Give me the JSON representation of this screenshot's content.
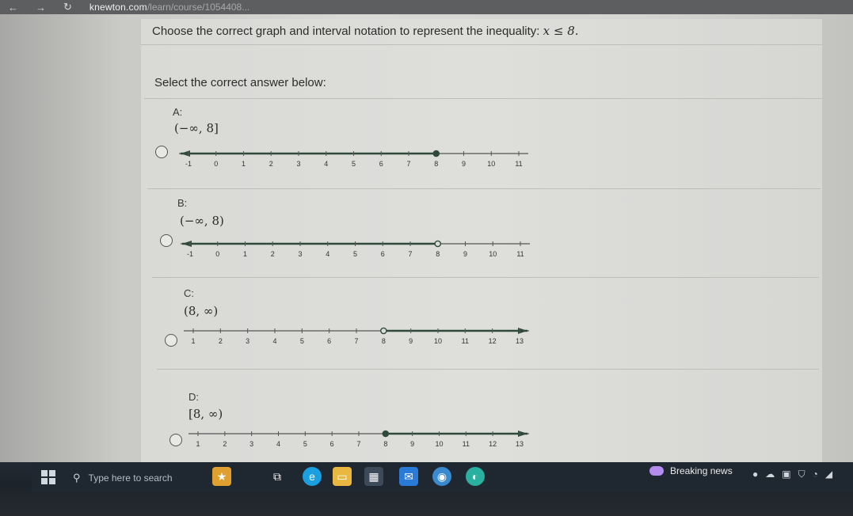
{
  "browser": {
    "back": "←",
    "forward": "→",
    "reload": "↻",
    "url": "knewton.com",
    "url_path": "/learn/course/1054408..."
  },
  "question": {
    "text": "Choose the correct graph and interval notation to represent the inequality: ",
    "inequality": "x ≤ 8."
  },
  "prompt": "Select the correct answer below:",
  "options": [
    {
      "label": "A:",
      "interval": "(−∞, 8]",
      "ticks": [
        -1,
        0,
        1,
        2,
        3,
        4,
        5,
        6,
        7,
        8,
        9,
        10,
        11
      ],
      "point": 8,
      "point_type": "closed",
      "direction": "left"
    },
    {
      "label": "B:",
      "interval": "(−∞, 8)",
      "ticks": [
        -1,
        0,
        1,
        2,
        3,
        4,
        5,
        6,
        7,
        8,
        9,
        10,
        11
      ],
      "point": 8,
      "point_type": "open",
      "direction": "left"
    },
    {
      "label": "C:",
      "interval": "(8, ∞)",
      "ticks": [
        1,
        2,
        3,
        4,
        5,
        6,
        7,
        8,
        9,
        10,
        11,
        12,
        13
      ],
      "point": 8,
      "point_type": "open",
      "direction": "right"
    },
    {
      "label": "D:",
      "interval": "[8, ∞)",
      "ticks": [
        1,
        2,
        3,
        4,
        5,
        6,
        7,
        8,
        9,
        10,
        11,
        12,
        13
      ],
      "point": 8,
      "point_type": "closed",
      "direction": "right"
    }
  ],
  "taskbar": {
    "search_placeholder": "Type here to search",
    "news": "Breaking news"
  }
}
